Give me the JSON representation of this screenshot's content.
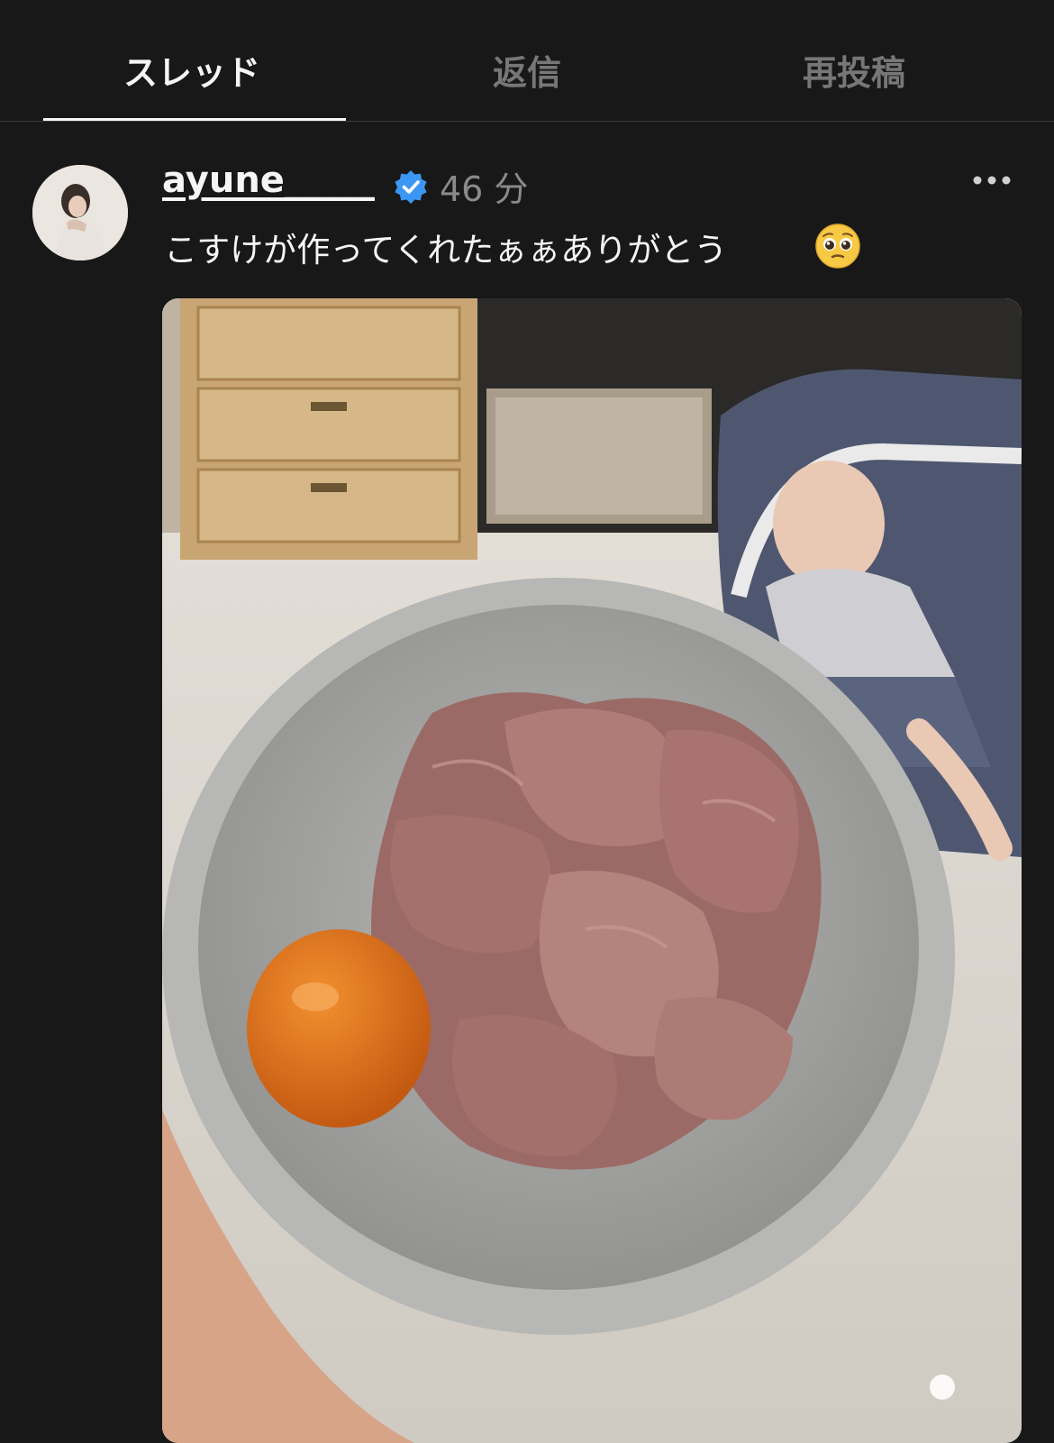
{
  "tabs": [
    {
      "label": "スレッド",
      "active": true
    },
    {
      "label": "返信",
      "active": false
    },
    {
      "label": "再投稿",
      "active": false
    }
  ],
  "post": {
    "username": "ayune_____",
    "verified": true,
    "time": "46 分",
    "caption": "こすけが作ってくれたぁぁありがとう",
    "caption_emoji": "pleading-face-emoji",
    "avatar_icon": "profile-photo",
    "more_icon": "more-horizontal-icon",
    "photo_description_icon": "photo"
  },
  "colors": {
    "background": "#181818",
    "text_primary": "#f3f5f7",
    "text_secondary": "#8a8a8a",
    "verified_badge": "#3b97f3",
    "divider": "#3a3a3a"
  }
}
